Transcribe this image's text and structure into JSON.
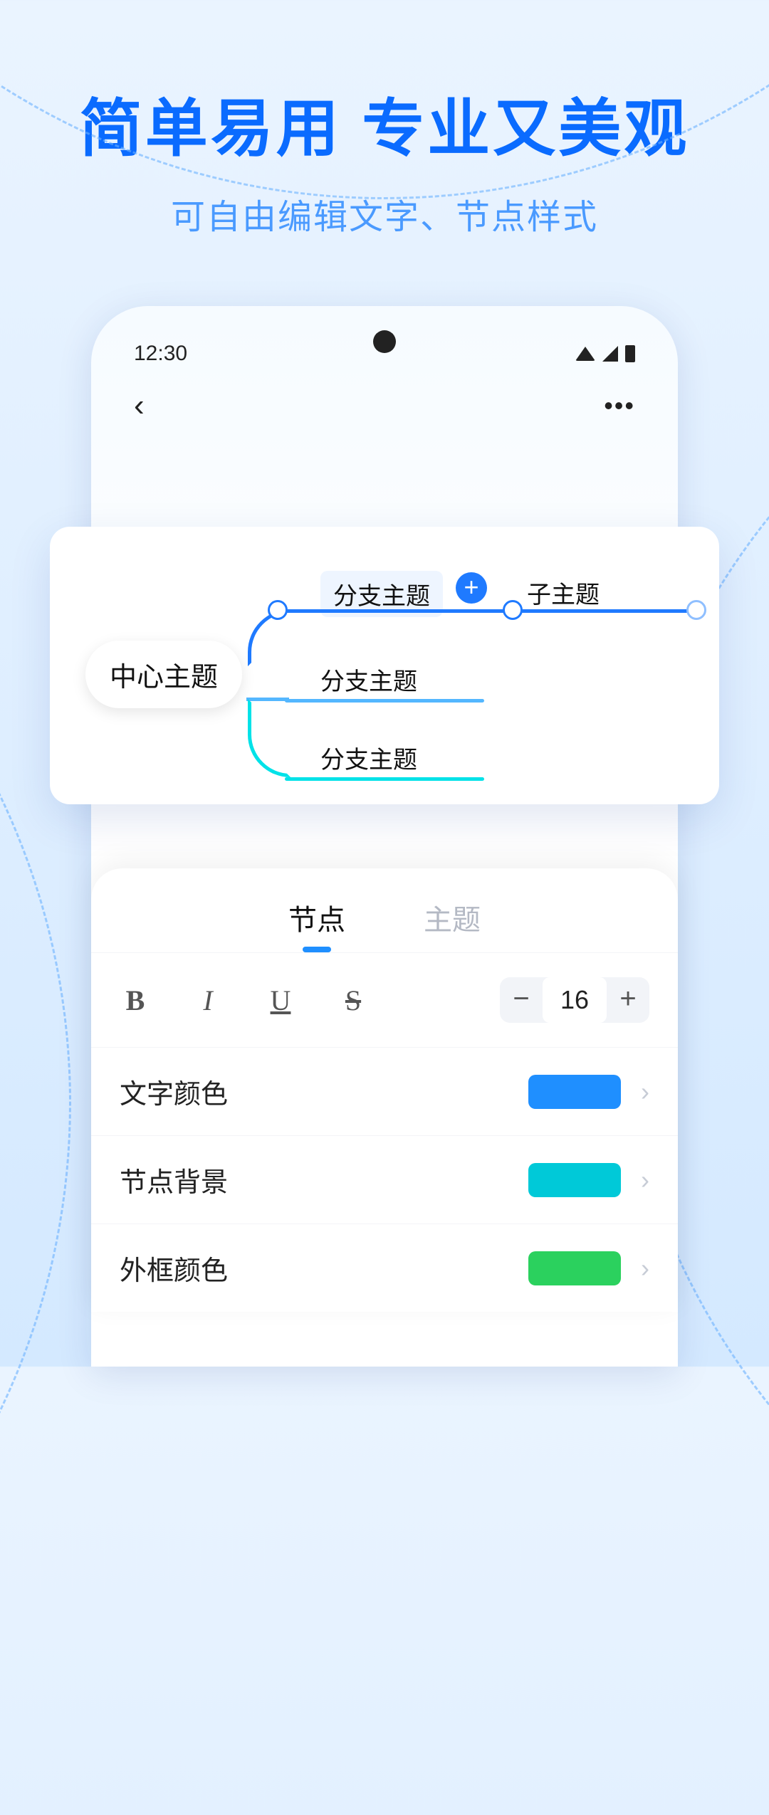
{
  "hero": {
    "title": "简单易用  专业又美观",
    "subtitle": "可自由编辑文字、节点样式"
  },
  "status": {
    "time": "12:30"
  },
  "nav": {
    "back": "‹",
    "more": "•••"
  },
  "mindmap": {
    "center": "中心主题",
    "branch1": "分支主题",
    "sub1": "子主题",
    "branch2": "分支主题",
    "branch3": "分支主题",
    "add": "+"
  },
  "panel": {
    "tabs": {
      "node": "节点",
      "theme": "主题"
    },
    "bold": "B",
    "italic": "I",
    "underline": "U",
    "strike": "S",
    "minus": "−",
    "plus": "+",
    "font_size": "16",
    "rows": {
      "text_color": {
        "label": "文字颜色",
        "swatch": "#1f8fff"
      },
      "node_bg": {
        "label": "节点背景",
        "swatch": "#00c9d8"
      },
      "border": {
        "label": "外框颜色",
        "swatch": "#2bd15e"
      }
    },
    "chev": "›"
  }
}
